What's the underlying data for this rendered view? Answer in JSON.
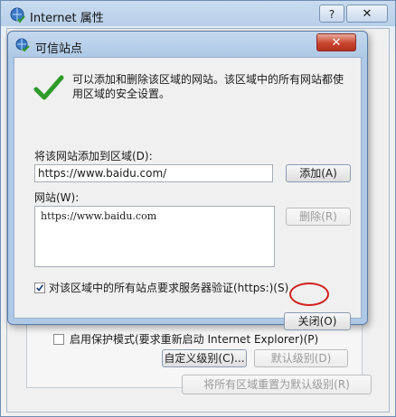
{
  "outer_window": {
    "title": "Internet 属性",
    "help_label": "?",
    "close_label": "✕",
    "protected_mode_label": "启用保护模式(要求重新启动 Internet Explorer)(P)",
    "custom_level_label": "自定义级别(C)...",
    "default_level_label": "默认级别(D)",
    "reset_all_label": "将所有区域重置为默认级别(R)"
  },
  "dialog": {
    "title": "可信站点",
    "close_label": "✕",
    "message": "可以添加和删除该区域的网站。该区域中的所有网站都使用区域的安全设置。",
    "add_label": "将该网站添加到区域(D):",
    "add_input_value": "https://www.baidu.com/",
    "add_button": "添加(A)",
    "sites_label": "网站(W):",
    "sites": [
      "https://www.baidu.com"
    ],
    "remove_button": "删除(R)",
    "require_https_label": "对该区域中的所有站点要求服务器验证(https:)(S)",
    "require_https_checked": true,
    "close_button": "关闭(O)"
  },
  "icons": {
    "window": "globe-check-icon",
    "success": "green-checkmark-icon"
  },
  "colors": {
    "highlight_ring": "#d21f1f",
    "checkmark": "#2e9a2a"
  }
}
